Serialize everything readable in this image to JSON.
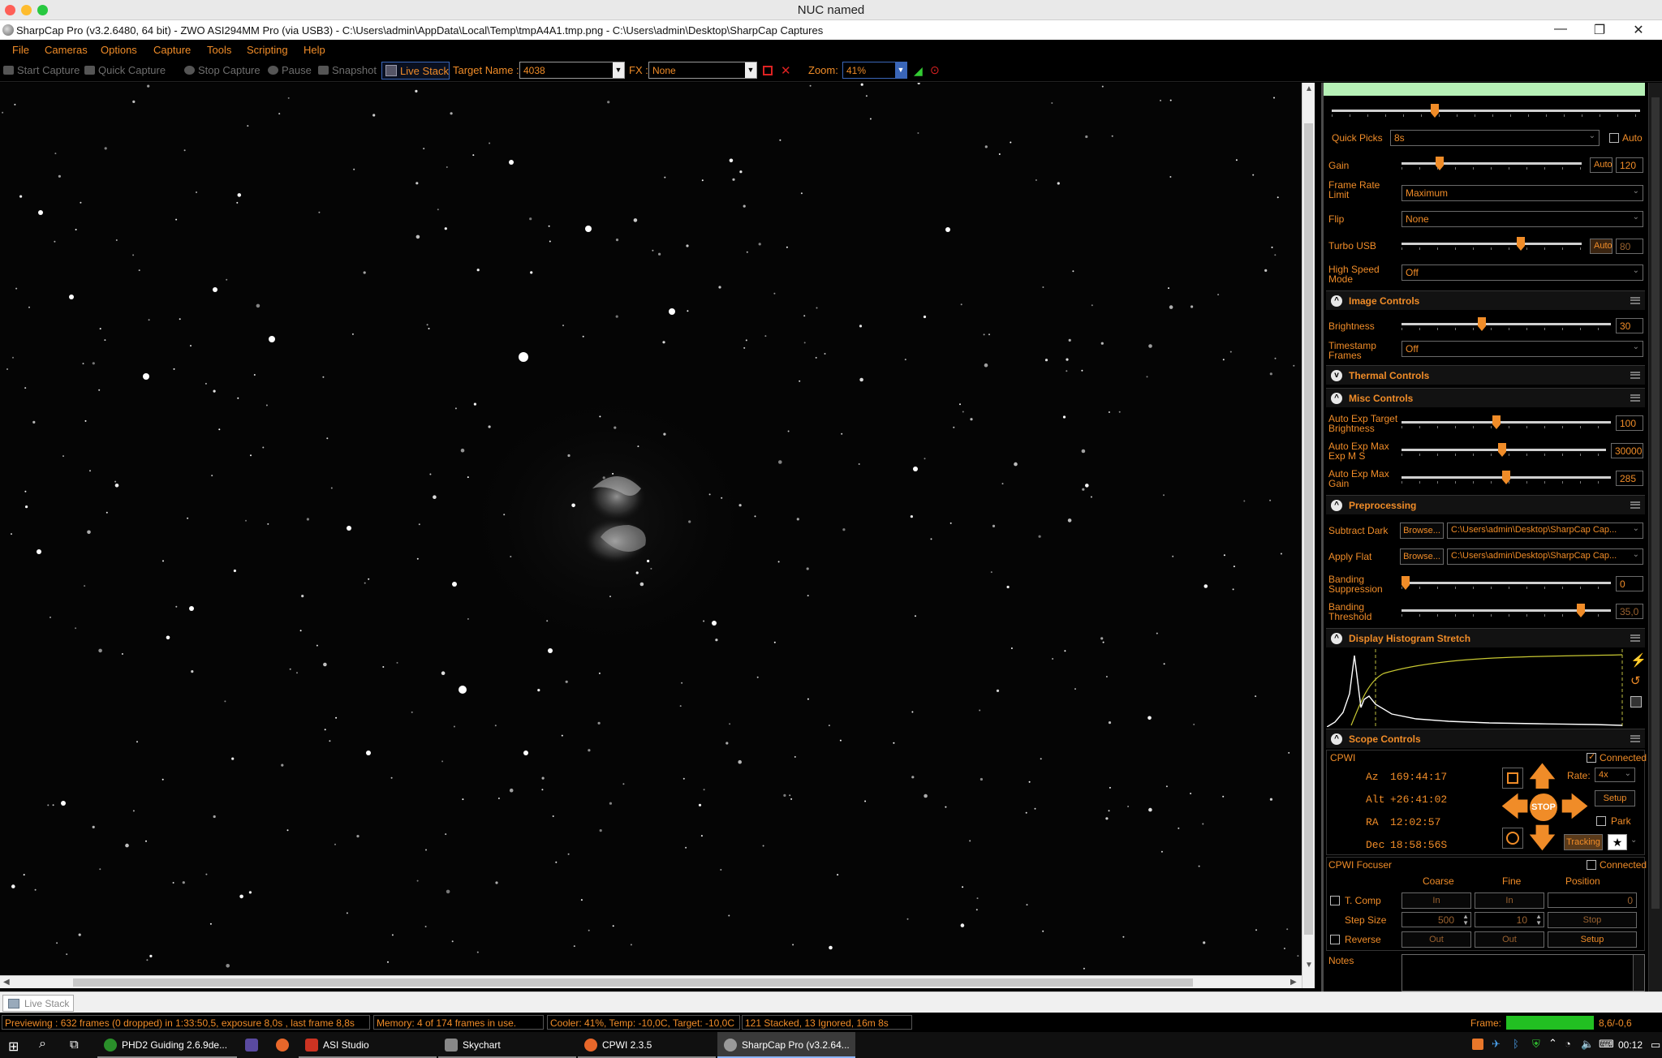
{
  "mac_window": {
    "title": "NUC named"
  },
  "window": {
    "title": "SharpCap Pro (v3.2.6480, 64 bit) - ZWO ASI294MM Pro (via USB3) - C:\\Users\\admin\\AppData\\Local\\Temp\\tmpA4A1.tmp.png - C:\\Users\\admin\\Desktop\\SharpCap Captures",
    "minimize": "—",
    "restore": "❐",
    "close": "✕"
  },
  "menu": [
    "File",
    "Cameras",
    "Options",
    "Capture",
    "Tools",
    "Scripting",
    "Help"
  ],
  "toolbar": {
    "start_capture": "Start Capture",
    "quick_capture": "Quick Capture",
    "stop_capture": "Stop Capture",
    "pause": "Pause",
    "snapshot": "Snapshot",
    "live_stack": "Live Stack",
    "target_name_label": "Target Name :",
    "target_name_value": "4038",
    "fx_label": "FX :",
    "fx_value": "None",
    "zoom_label": "Zoom:",
    "zoom_value": "41%"
  },
  "panel": {
    "quick_picks": {
      "label": "Quick Picks",
      "value": "8s",
      "auto": "Auto"
    },
    "gain": {
      "label": "Gain",
      "auto": "Auto",
      "value": "120",
      "level": 0.2
    },
    "frame_rate_limit": {
      "label1": "Frame Rate",
      "label2": "Limit",
      "value": "Maximum"
    },
    "flip": {
      "label": "Flip",
      "value": "None"
    },
    "turbo_usb": {
      "label": "Turbo USB",
      "auto": "Auto",
      "value": "80",
      "level": 0.67
    },
    "high_speed_mode": {
      "label1": "High Speed",
      "label2": "Mode",
      "value": "Off"
    },
    "image_controls": {
      "title": "Image Controls",
      "brightness": {
        "label": "Brightness",
        "value": "30",
        "level": 0.38
      },
      "timestamp_frames": {
        "label1": "Timestamp",
        "label2": "Frames",
        "value": "Off"
      }
    },
    "thermal_controls": {
      "title": "Thermal Controls"
    },
    "misc_controls": {
      "title": "Misc Controls",
      "auto_exp_target_brightness": {
        "label1": "Auto Exp Target",
        "label2": "Brightness",
        "value": "100",
        "level": 0.45
      },
      "auto_exp_max_exp": {
        "label1": "Auto Exp Max",
        "label2": "Exp M S",
        "value": "30000",
        "level": 0.49
      },
      "auto_exp_max_gain": {
        "label1": "Auto Exp Max",
        "label2": "Gain",
        "value": "285",
        "level": 0.5
      }
    },
    "preprocessing": {
      "title": "Preprocessing",
      "subtract_dark": {
        "label": "Subtract Dark",
        "browse": "Browse...",
        "path": "C:\\Users\\admin\\Desktop\\SharpCap Cap..."
      },
      "apply_flat": {
        "label": "Apply Flat",
        "browse": "Browse...",
        "path": "C:\\Users\\admin\\Desktop\\SharpCap Cap..."
      },
      "banding_suppression": {
        "label1": "Banding",
        "label2": "Suppression",
        "value": "0",
        "level": 0.0
      },
      "banding_threshold": {
        "label1": "Banding",
        "label2": "Threshold",
        "value": "35,0",
        "level": 0.87
      }
    },
    "display_histogram_stretch": {
      "title": "Display Histogram Stretch"
    },
    "scope_controls": {
      "title": "Scope Controls",
      "device": "CPWI",
      "connected": "Connected",
      "az_label": "Az",
      "az_value": "169:44:17",
      "alt_label": "Alt",
      "alt_value": "+26:41:02",
      "ra_label": "RA",
      "ra_value": "12:02:57",
      "dec_label": "Dec",
      "dec_value": "18:58:56S",
      "rate_label": "Rate:",
      "rate_value": "4x",
      "setup": "Setup",
      "park": "Park",
      "tracking": "Tracking",
      "stop": "STOP"
    },
    "focuser": {
      "title": "CPWI Focuser",
      "connected": "Connected",
      "coarse": "Coarse",
      "fine": "Fine",
      "position": "Position",
      "t_comp": "T. Comp",
      "in": "In",
      "position_value": "0",
      "step_size": "Step Size",
      "coarse_step": "500",
      "fine_step": "10",
      "stop": "Stop",
      "reverse": "Reverse",
      "out": "Out",
      "setup": "Setup"
    },
    "notes": {
      "label": "Notes"
    }
  },
  "tab": {
    "live_stack": "Live Stack"
  },
  "status": {
    "previewing": "Previewing : 632 frames (0 dropped) in 1:33:50,5, exposure 8,0s , last frame 8,8s",
    "memory": "Memory: 4 of 174 frames in use.",
    "cooler": "Cooler: 41%, Temp: -10,0C, Target: -10,0C",
    "stacked": "121 Stacked, 13 Ignored, 16m 8s",
    "frame_label": "Frame:",
    "frame_value": "8,6/-0,6"
  },
  "taskbar": {
    "items": [
      "PHD2 Guiding 2.6.9de...",
      "ASI Studio",
      "Skychart",
      "CPWI 2.3.5",
      "SharpCap Pro (v3.2.64..."
    ],
    "clock": "00:12"
  },
  "colors": {
    "accent": "#f08c28",
    "panel_bg": "#000000",
    "histogram_curve": "#c8c832",
    "frame_bar": "#22c022"
  }
}
